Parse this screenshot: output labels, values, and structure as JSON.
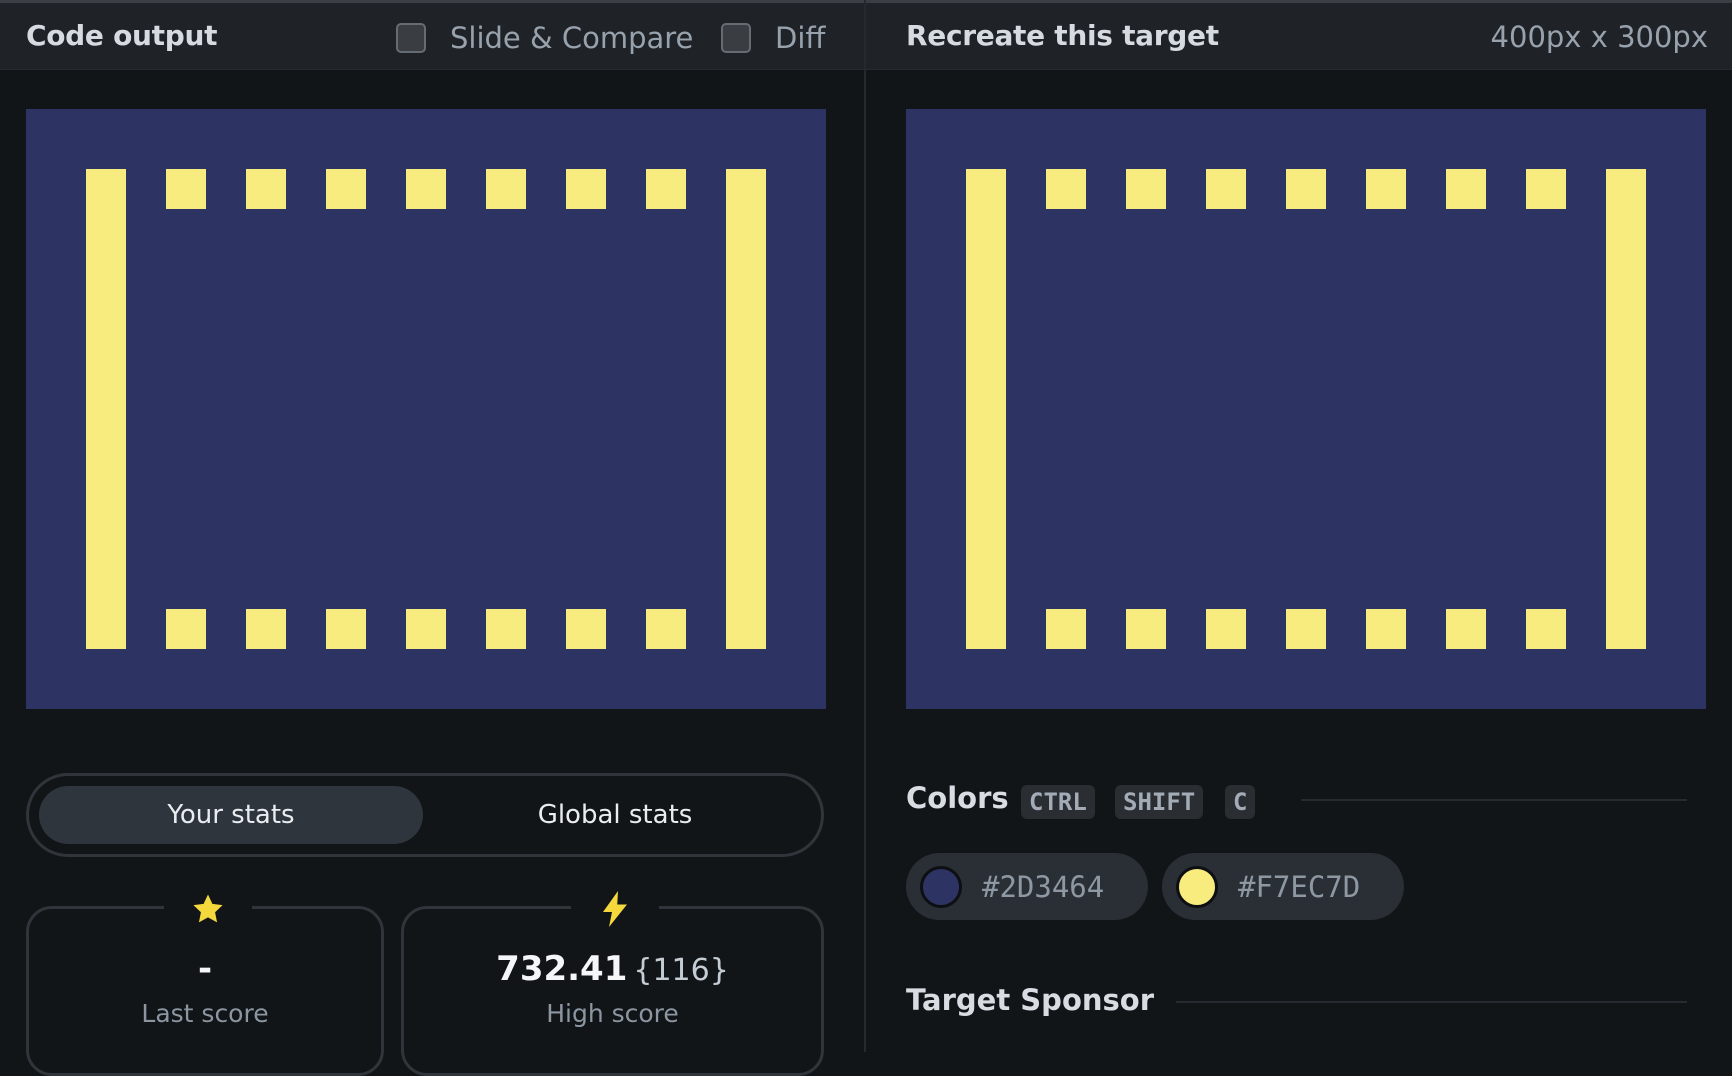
{
  "left": {
    "title": "Code output",
    "slide_compare_label": "Slide & Compare",
    "diff_label": "Diff"
  },
  "right": {
    "title": "Recreate this target",
    "size_label": "400px x 300px"
  },
  "stats": {
    "tab_your": "Your stats",
    "tab_global": "Global stats",
    "last_score_value": "-",
    "last_score_label": "Last score",
    "high_score_value": "732.41",
    "high_score_extra": "{116}",
    "high_score_label": "High score",
    "last_score_icon": "star-icon",
    "high_score_icon": "lightning-icon"
  },
  "colors": {
    "title": "Colors",
    "shortcut_keys": [
      "CTRL",
      "SHIFT",
      "C"
    ],
    "swatches": [
      {
        "hex": "#2D3464",
        "label": "#2D3464"
      },
      {
        "hex": "#F7EC7D",
        "label": "#F7EC7D"
      }
    ]
  },
  "sponsor": {
    "title": "Target Sponsor"
  },
  "theme": {
    "canvas_background": "#2D3464",
    "shape_color": "#F7EC7D",
    "accent_yellow": "#F5D83B"
  }
}
